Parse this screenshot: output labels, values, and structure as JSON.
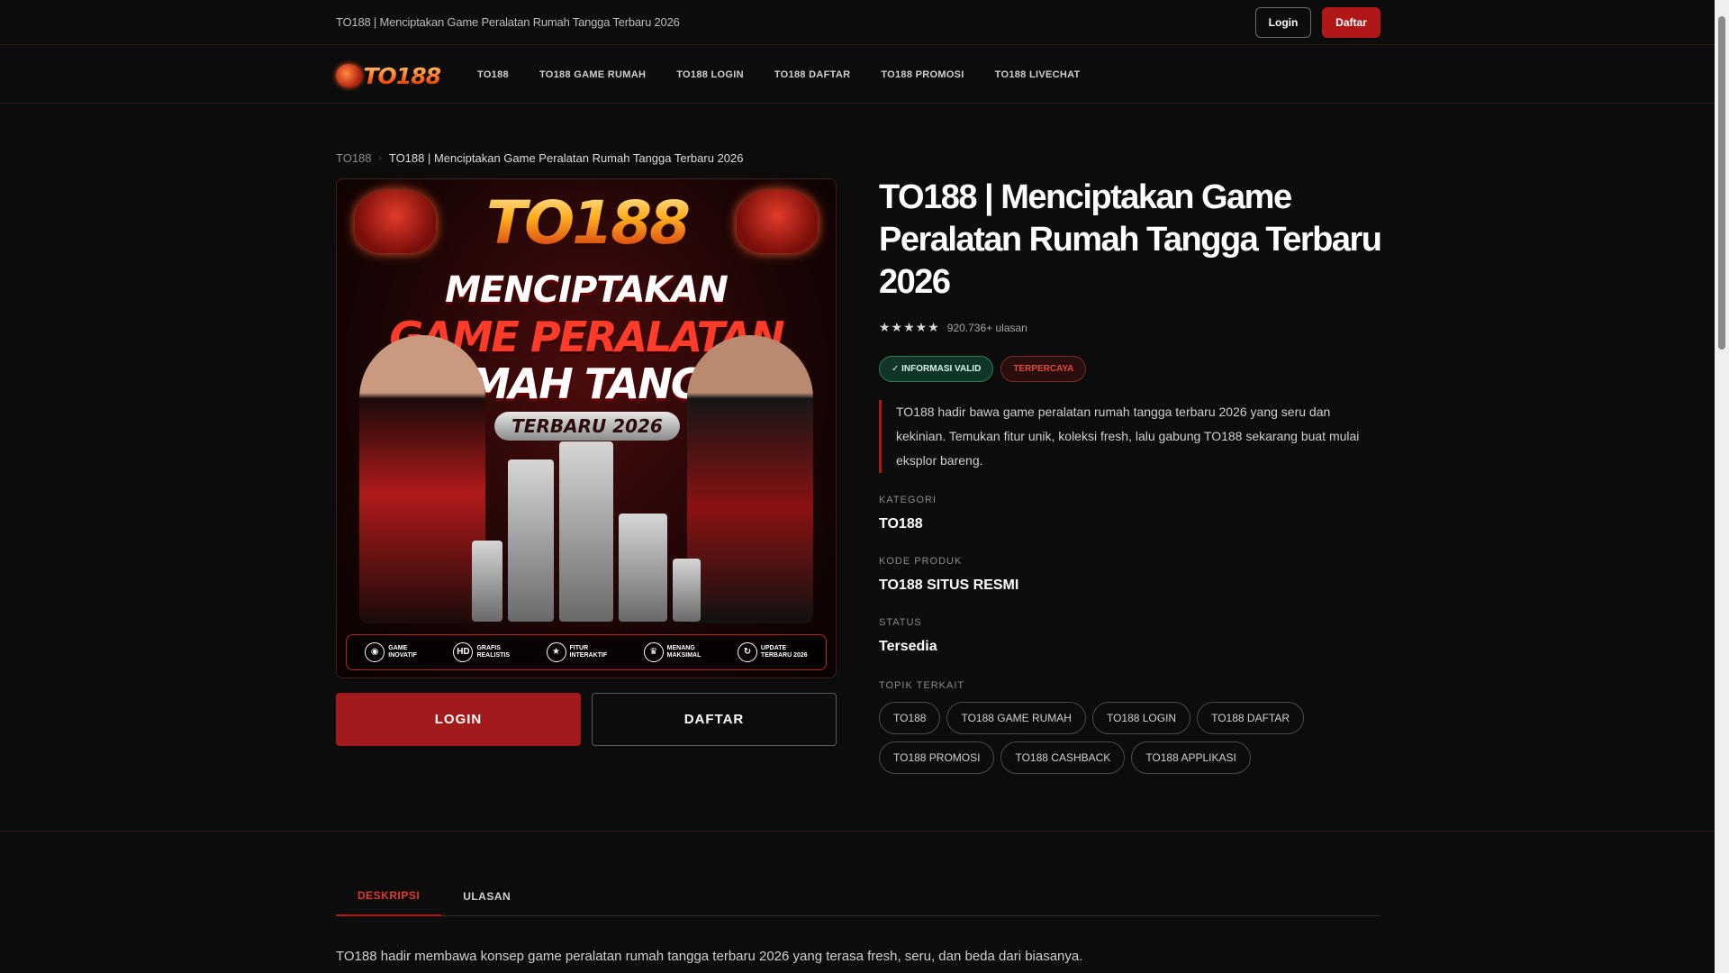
{
  "topbar": {
    "site_title": "TO188 | Menciptakan Game Peralatan Rumah Tangga Terbaru 2026",
    "login_label": "Login",
    "daftar_label": "Daftar"
  },
  "nav": {
    "logo_text": "TO188",
    "items": [
      "TO188",
      "TO188 GAME RUMAH",
      "TO188 LOGIN",
      "TO188 DAFTAR",
      "TO188 PROMOSI",
      "TO188 LIVECHAT"
    ]
  },
  "breadcrumb": {
    "home": "TO188",
    "current": "TO188 | Menciptakan Game Peralatan Rumah Tangga Terbaru 2026"
  },
  "image": {
    "logo": "TO188",
    "line1": "MENCIPTAKAN",
    "line2": "GAME PERALATAN",
    "line3": "RUMAH TANGGA",
    "badge": "TERBARU 2026",
    "features": [
      {
        "icon": "gamepad-icon",
        "glyph": "◉",
        "label1": "GAME",
        "label2": "INOVATIF"
      },
      {
        "icon": "hd-icon",
        "glyph": "HD",
        "label1": "GRAFIS",
        "label2": "REALISTIS"
      },
      {
        "icon": "star-icon",
        "glyph": "★",
        "label1": "FITUR",
        "label2": "INTERAKTIF"
      },
      {
        "icon": "trophy-icon",
        "glyph": "♛",
        "label1": "MENANG",
        "label2": "MAKSIMAL"
      },
      {
        "icon": "refresh-icon",
        "glyph": "↻",
        "label1": "UPDATE",
        "label2": "TERBARU 2026"
      }
    ]
  },
  "buttons": {
    "login": "LOGIN",
    "daftar": "DAFTAR"
  },
  "product": {
    "title": "TO188 | Menciptakan Game Peralatan Rumah Tangga Terbaru 2026",
    "stars": "★★★★★",
    "rating_value": 5,
    "review_count": "920.736+ ulasan",
    "badge_valid": "✓ INFORMASI VALID",
    "badge_trust": "TERPERCAYA",
    "description": "TO188 hadir bawa game peralatan rumah tangga terbaru 2026 yang seru dan kekinian. Temukan fitur unik, koleksi fresh, lalu gabung TO188 sekarang buat mulai eksplor bareng.",
    "meta": [
      {
        "label": "KATEGORI",
        "value": "TO188"
      },
      {
        "label": "KODE PRODUK",
        "value": "TO188 SITUS RESMI"
      },
      {
        "label": "STATUS",
        "value": "Tersedia"
      }
    ],
    "topik_label": "TOPIK TERKAIT",
    "tags": [
      "TO188",
      "TO188 GAME RUMAH",
      "TO188 LOGIN",
      "TO188 DAFTAR",
      "TO188 PROMOSI",
      "TO188 CASHBACK",
      "TO188 APPLIKASI"
    ]
  },
  "tabs": [
    {
      "label": "DESKRIPSI",
      "active": true
    },
    {
      "label": "ULASAN",
      "active": false
    }
  ],
  "body_text": "TO188 hadir membawa konsep game peralatan rumah tangga terbaru 2026 yang terasa fresh, seru, dan beda dari biasanya.",
  "colors": {
    "accent": "#b01818",
    "background": "#0c0c0c",
    "valid_green": "#0f3526"
  }
}
